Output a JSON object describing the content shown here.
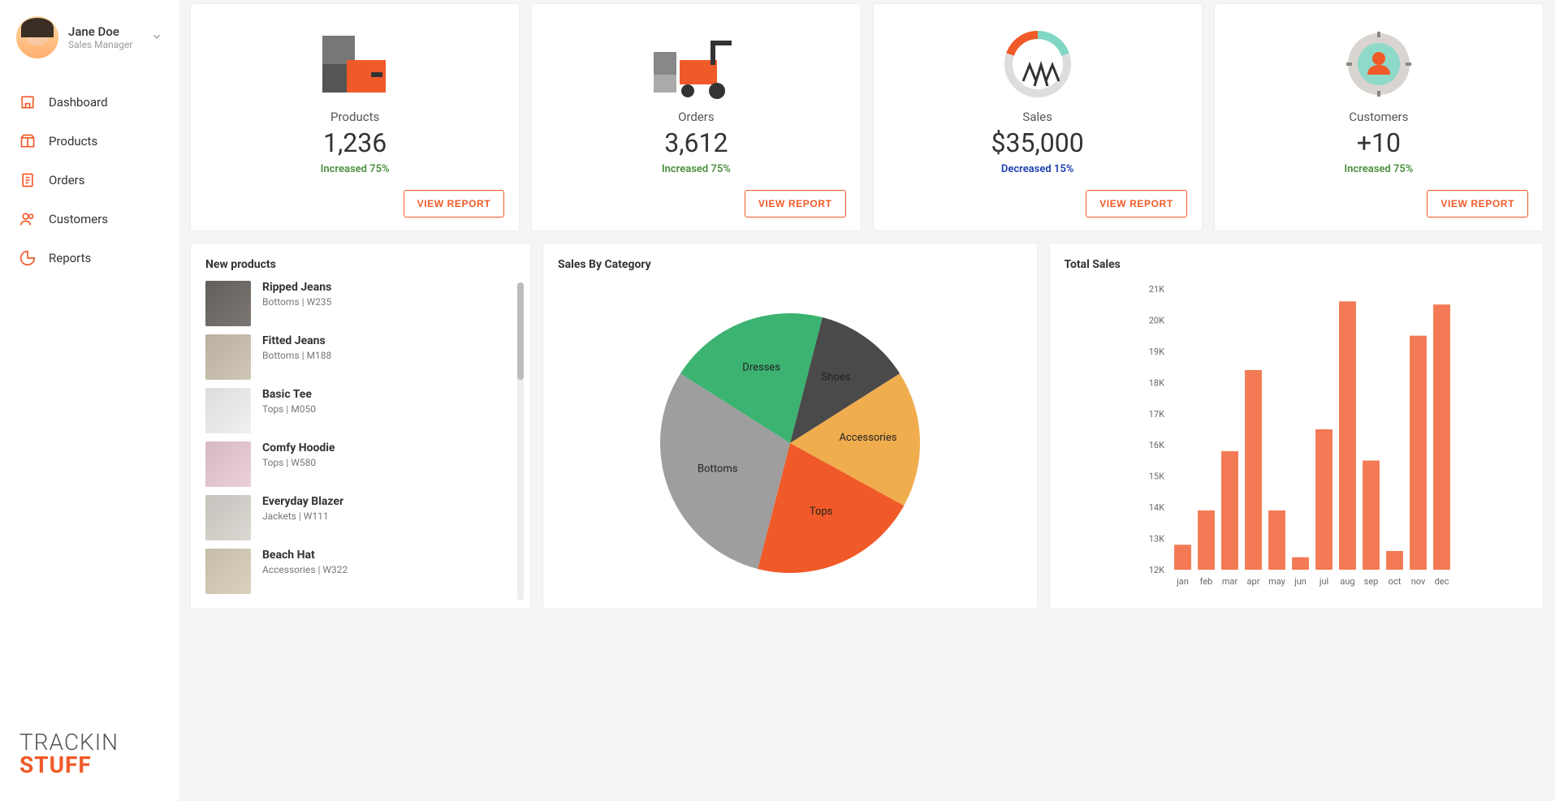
{
  "user": {
    "name": "Jane Doe",
    "role": "Sales Manager"
  },
  "nav": [
    {
      "label": "Dashboard",
      "icon": "shop-icon"
    },
    {
      "label": "Products",
      "icon": "box-icon"
    },
    {
      "label": "Orders",
      "icon": "clipboard-icon"
    },
    {
      "label": "Customers",
      "icon": "people-icon"
    },
    {
      "label": "Reports",
      "icon": "piechart-icon"
    }
  ],
  "logo": {
    "line1": "TRACKIN",
    "line2": "STUFF"
  },
  "stats": [
    {
      "label": "Products",
      "value": "1,236",
      "delta": "Increased 75%",
      "dir": "inc",
      "button": "VIEW REPORT"
    },
    {
      "label": "Orders",
      "value": "3,612",
      "delta": "Increased 75%",
      "dir": "inc",
      "button": "VIEW REPORT"
    },
    {
      "label": "Sales",
      "value": "$35,000",
      "delta": "Decreased 15%",
      "dir": "dec",
      "button": "VIEW REPORT"
    },
    {
      "label": "Customers",
      "value": "+10",
      "delta": "Increased 75%",
      "dir": "inc",
      "button": "VIEW REPORT"
    }
  ],
  "new_products": {
    "title": "New products",
    "items": [
      {
        "name": "Ripped Jeans",
        "category": "Bottoms",
        "sku": "W235"
      },
      {
        "name": "Fitted Jeans",
        "category": "Bottoms",
        "sku": "M188"
      },
      {
        "name": "Basic Tee",
        "category": "Tops",
        "sku": "M050"
      },
      {
        "name": "Comfy Hoodie",
        "category": "Tops",
        "sku": "W580"
      },
      {
        "name": "Everyday Blazer",
        "category": "Jackets",
        "sku": "W111"
      },
      {
        "name": "Beach Hat",
        "category": "Accessories",
        "sku": "W322"
      }
    ]
  },
  "pie": {
    "title": "Sales By Category",
    "chart_data": {
      "type": "pie",
      "series": [
        {
          "name": "Shoes",
          "value": 12,
          "color": "#4a4a4a"
        },
        {
          "name": "Accessories",
          "value": 17,
          "color": "#f0ad4e"
        },
        {
          "name": "Tops",
          "value": 21,
          "color": "#f05a28"
        },
        {
          "name": "Bottoms",
          "value": 30,
          "color": "#9e9e9e"
        },
        {
          "name": "Dresses",
          "value": 20,
          "color": "#3cb371"
        }
      ]
    }
  },
  "bar": {
    "title": "Total Sales",
    "chart_data": {
      "type": "bar",
      "categories": [
        "jan",
        "feb",
        "mar",
        "apr",
        "may",
        "jun",
        "jul",
        "aug",
        "sep",
        "oct",
        "nov",
        "dec"
      ],
      "values": [
        12800,
        13900,
        15800,
        18400,
        13900,
        12400,
        16500,
        20600,
        15500,
        12600,
        19500,
        20500
      ],
      "ylim": [
        12000,
        21000
      ],
      "yticks": [
        "12K",
        "13K",
        "14K",
        "15K",
        "16K",
        "17K",
        "18K",
        "19K",
        "20K",
        "21K"
      ],
      "bar_color": "#f37a55",
      "ylabel": "",
      "xlabel": "",
      "title": "Total Sales"
    }
  }
}
